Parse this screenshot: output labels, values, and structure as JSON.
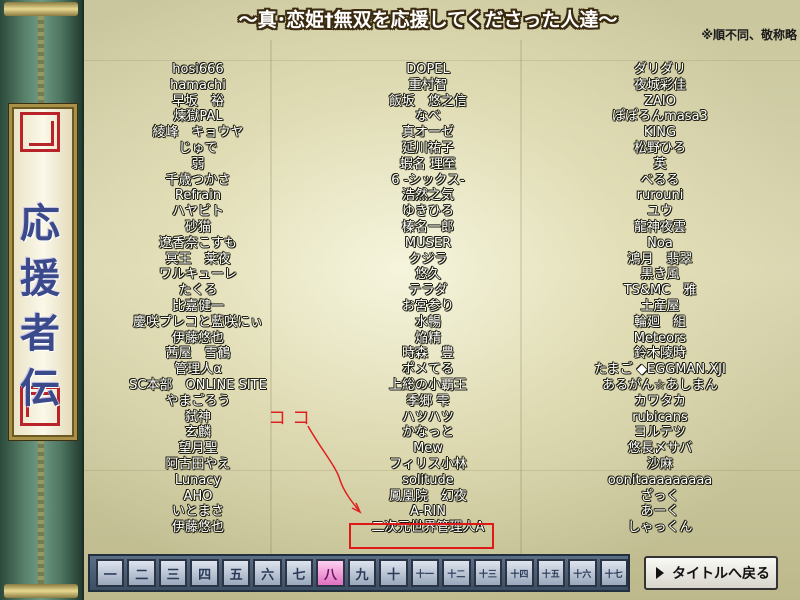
{
  "title": "～真･恋姫†無双を応援してくださった人達～",
  "note": "※順不同、敬称略",
  "side_title": [
    "応",
    "援",
    "者",
    "伝"
  ],
  "columns": [
    [
      "hosi666",
      "hamachi",
      "早坂　裕",
      "煉獄PAL",
      "綾峰　キョウヤ",
      "じゅで",
      "弱",
      "千歳つかさ",
      "Refrain",
      "ハヤビト",
      "砂猫",
      "遼香奈こすも",
      "冥王　莱夜",
      "ワルキューレ",
      "たくろ",
      "比嘉健一",
      "慶咲プレコと藍咲にぃ",
      "伊藤悠也",
      "茜屋　雪鶴",
      "管理人α",
      "SC本部　ONLINE SITE",
      "やまごろう",
      "弑神",
      "玄麟",
      "望月聖",
      "阿古田やえ",
      "Lunacy",
      "AHO",
      "いとまさ",
      "伊藤悠也"
    ],
    [
      "DOPEL",
      "重村智",
      "飯坂　悠之信",
      "なべ",
      "真オーゼ",
      "延川祐子",
      "蝦名 理至",
      "6 -シックス-",
      "浩然之気",
      "ゆきひろ",
      "榛名一郎",
      "MUSER",
      "クジラ",
      "悠久",
      "テラダ",
      "お宮参り",
      "水暢",
      "焔精",
      "時森　豊",
      "ポメてる",
      "上総の小覇王",
      "季郷 雫",
      "ハツハツ",
      "かなっと",
      "Mew",
      "フィリス小林",
      "solitude",
      "鳳凰院　幻夜",
      "A-RIN",
      "二次元世界管理人A"
    ],
    [
      "ダリダリ",
      "夜城彩佳",
      "ZAIO",
      "ぽぽろんmasa3",
      "KING",
      "松野ひろ",
      "英",
      "べるる",
      "rurouni",
      "ユウ",
      "龍神夜雲",
      "Noa",
      "鴻月　翡翠",
      "黒き風",
      "TS&MC　雅",
      "土産屋",
      "輪廻　組",
      "Meteors",
      "鈴木陵時",
      "たまご ◆EGGMAN.XJI",
      "あるがん☆あしまん",
      "カワタカ",
      "rubicans",
      "ヨルテツ",
      "悠長〆サバ",
      "沙麻",
      "oonitaaaaaaaaa",
      "ざっく",
      "あーく",
      "しゃっくん"
    ]
  ],
  "annotation": {
    "label": "ココ",
    "color": "#e02020",
    "target": "二次元世界管理人A"
  },
  "page_buttons": [
    {
      "label": "一",
      "active": false
    },
    {
      "label": "二",
      "active": false
    },
    {
      "label": "三",
      "active": false
    },
    {
      "label": "四",
      "active": false
    },
    {
      "label": "五",
      "active": false
    },
    {
      "label": "六",
      "active": false
    },
    {
      "label": "七",
      "active": false
    },
    {
      "label": "八",
      "active": true
    },
    {
      "label": "九",
      "active": false
    },
    {
      "label": "十",
      "active": false
    },
    {
      "label": "十一",
      "active": false
    },
    {
      "label": "十二",
      "active": false
    },
    {
      "label": "十三",
      "active": false
    },
    {
      "label": "十四",
      "active": false
    },
    {
      "label": "十五",
      "active": false
    },
    {
      "label": "十六",
      "active": false
    },
    {
      "label": "十七",
      "active": false
    }
  ],
  "back_button": {
    "label": "タイトルへ戻る",
    "icon": "play-triangle-icon"
  },
  "colors": {
    "name_text": "#ffffff",
    "name_outline": "#1e1e10",
    "annotation": "#e02020",
    "side_title": "#3a4a8a"
  }
}
